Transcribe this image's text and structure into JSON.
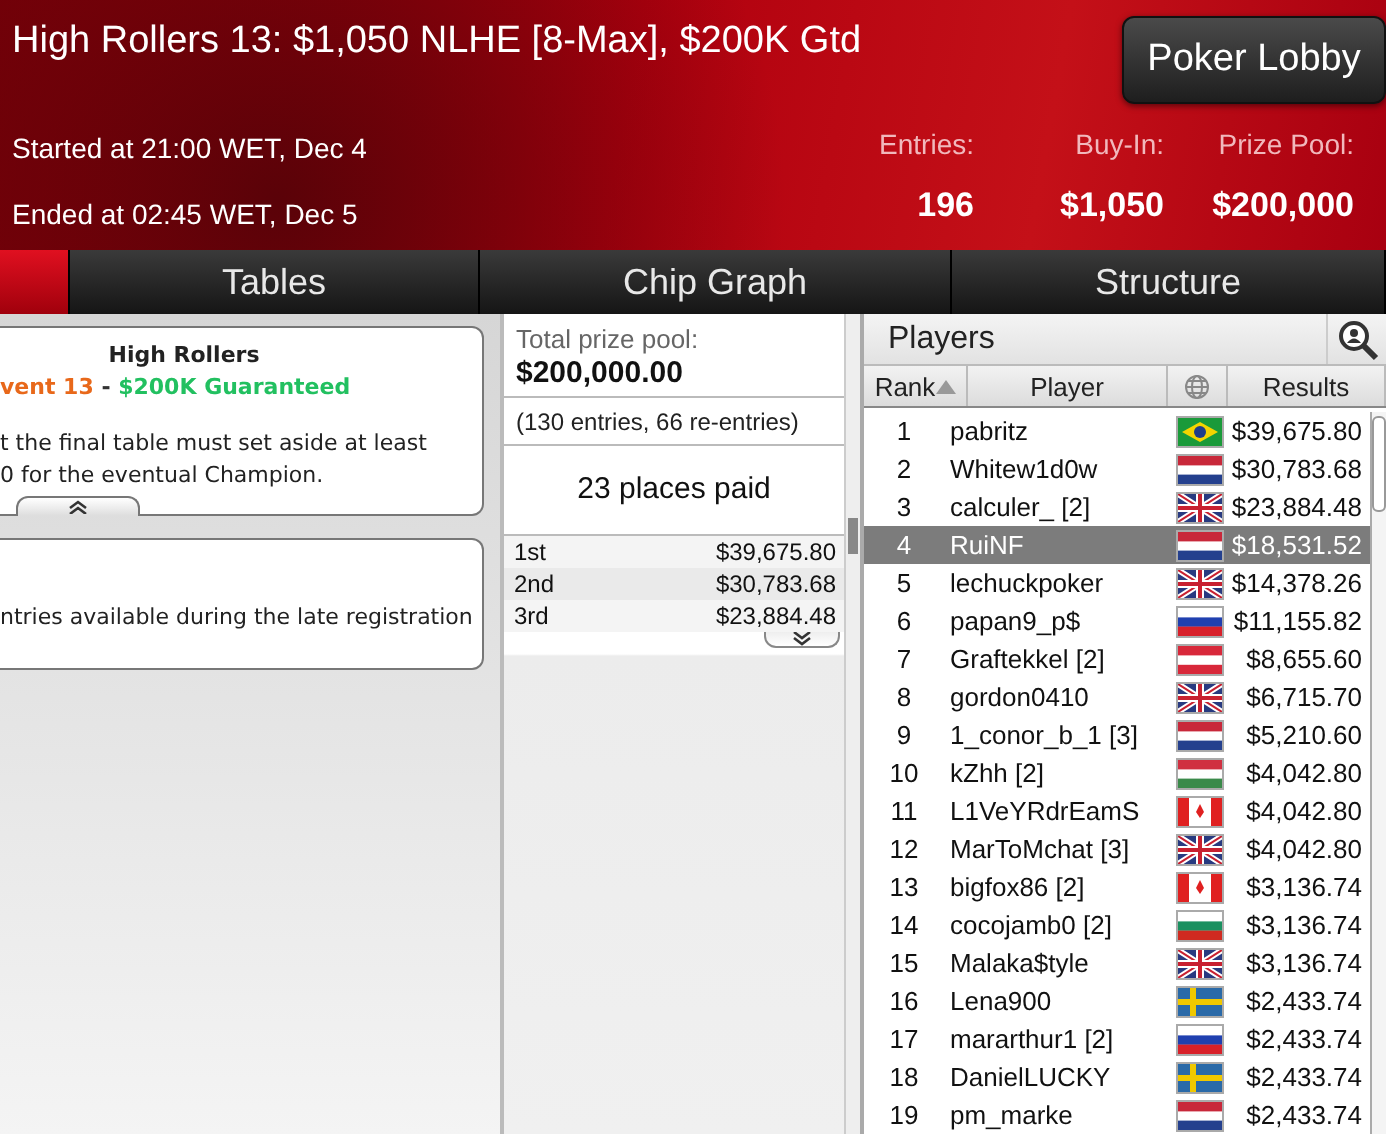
{
  "header": {
    "title": "High Rollers 13: $1,050 NLHE [8-Max], $200K Gtd",
    "lobby_button": "Poker Lobby",
    "started": "Started at 21:00 WET, Dec 4",
    "ended": "Ended at 02:45 WET, Dec 5",
    "stats": [
      {
        "label": "Entries:",
        "value": "196"
      },
      {
        "label": "Buy-In:",
        "value": "$1,050"
      },
      {
        "label": "Prize Pool:",
        "value": "$200,000"
      }
    ]
  },
  "tabs": [
    {
      "selected": true
    },
    {
      "label": "Tables",
      "selected": false
    },
    {
      "label": "Chip Graph",
      "selected": false
    },
    {
      "label": "Structure",
      "selected": false
    }
  ],
  "info_card": {
    "heading": "High Rollers",
    "subtitle": [
      {
        "text": "vent 13",
        "color": "#e8681a"
      },
      {
        "text": " - ",
        "color": "#333333"
      },
      {
        "text": "$200K Guaranteed",
        "color": "#22c060"
      }
    ],
    "body": "t the final table must set aside at least\n0 for the eventual Champion.",
    "expanded": true
  },
  "info_card_2": {
    "body": "ntries available during the late registration"
  },
  "prizes": {
    "label": "Total prize pool:",
    "total": "$200,000.00",
    "entries": "(130 entries, 66 re-entries)",
    "places": "23 places paid",
    "rows": [
      {
        "place": "1st",
        "amount": "$39,675.80"
      },
      {
        "place": "2nd",
        "amount": "$30,783.68"
      },
      {
        "place": "3rd",
        "amount": "$23,884.48"
      }
    ],
    "expanded": false
  },
  "players": {
    "title": "Players",
    "columns": [
      "Rank",
      "Player",
      "Results"
    ],
    "rows": [
      {
        "rank": "1",
        "name": "pabritz",
        "kind": "br",
        "result": "$39,675.80",
        "selected": false
      },
      {
        "rank": "2",
        "name": "Whitew1d0w",
        "kind": "nl",
        "result": "$30,783.68",
        "selected": false
      },
      {
        "rank": "3",
        "name": "calculer_ [2]",
        "kind": "gb",
        "result": "$23,884.48",
        "selected": false
      },
      {
        "rank": "4",
        "name": "RuiNF",
        "kind": "nl",
        "result": "$18,531.52",
        "selected": true
      },
      {
        "rank": "5",
        "name": "lechuckpoker",
        "kind": "gb",
        "result": "$14,378.26",
        "selected": false
      },
      {
        "rank": "6",
        "name": "papan9_p$",
        "kind": "ru",
        "result": "$11,155.82",
        "selected": false
      },
      {
        "rank": "7",
        "name": "Graftekkel [2]",
        "kind": "at",
        "result": "$8,655.60",
        "selected": false
      },
      {
        "rank": "8",
        "name": "gordon0410",
        "kind": "gb",
        "result": "$6,715.70",
        "selected": false
      },
      {
        "rank": "9",
        "name": "1_conor_b_1 [3]",
        "kind": "nl",
        "result": "$5,210.60",
        "selected": false
      },
      {
        "rank": "10",
        "name": "kZhh [2]",
        "kind": "hu",
        "result": "$4,042.80",
        "selected": false
      },
      {
        "rank": "11",
        "name": "L1VeYRdrEamS",
        "kind": "ca",
        "result": "$4,042.80",
        "selected": false
      },
      {
        "rank": "12",
        "name": "MarToMchat [3]",
        "kind": "gb",
        "result": "$4,042.80",
        "selected": false
      },
      {
        "rank": "13",
        "name": "bigfox86 [2]",
        "kind": "ca",
        "result": "$3,136.74",
        "selected": false
      },
      {
        "rank": "14",
        "name": "cocojamb0 [2]",
        "kind": "bg",
        "result": "$3,136.74",
        "selected": false
      },
      {
        "rank": "15",
        "name": "Malaka$tyle",
        "kind": "gb",
        "result": "$3,136.74",
        "selected": false
      },
      {
        "rank": "16",
        "name": "Lena900",
        "kind": "se",
        "result": "$2,433.74",
        "selected": false
      },
      {
        "rank": "17",
        "name": "mararthur1 [2]",
        "kind": "ru",
        "result": "$2,433.74",
        "selected": false
      },
      {
        "rank": "18",
        "name": "DanielLUCKY",
        "kind": "se",
        "result": "$2,433.74",
        "selected": false
      },
      {
        "rank": "19",
        "name": "pm_marke",
        "kind": "nl",
        "result": "$2,433.74",
        "selected": false
      }
    ]
  }
}
